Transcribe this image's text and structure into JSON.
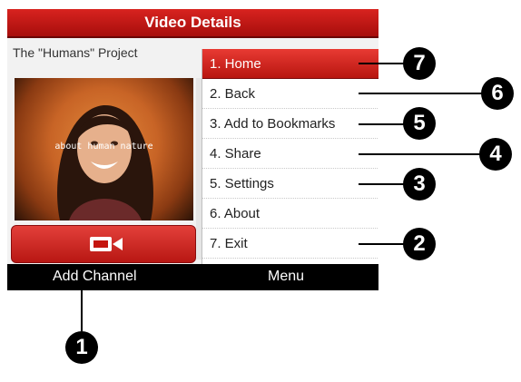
{
  "window": {
    "title": "Video Details"
  },
  "video": {
    "title": "The \"Humans\" Project",
    "caption": "about human nature"
  },
  "menu": {
    "items": [
      {
        "label": "1.  Home"
      },
      {
        "label": "2.  Back"
      },
      {
        "label": "3.  Add to Bookmarks"
      },
      {
        "label": "4.  Share"
      },
      {
        "label": "5.  Settings"
      },
      {
        "label": "6.  About"
      },
      {
        "label": "7.  Exit"
      }
    ]
  },
  "softkeys": {
    "left": "Add Channel",
    "right": "Menu"
  },
  "callouts": [
    "1",
    "2",
    "3",
    "4",
    "5",
    "6",
    "7"
  ],
  "colors": {
    "accent": "#c4150f",
    "softbar": "#000000"
  },
  "icons": {
    "camera": "video-camera-icon"
  }
}
